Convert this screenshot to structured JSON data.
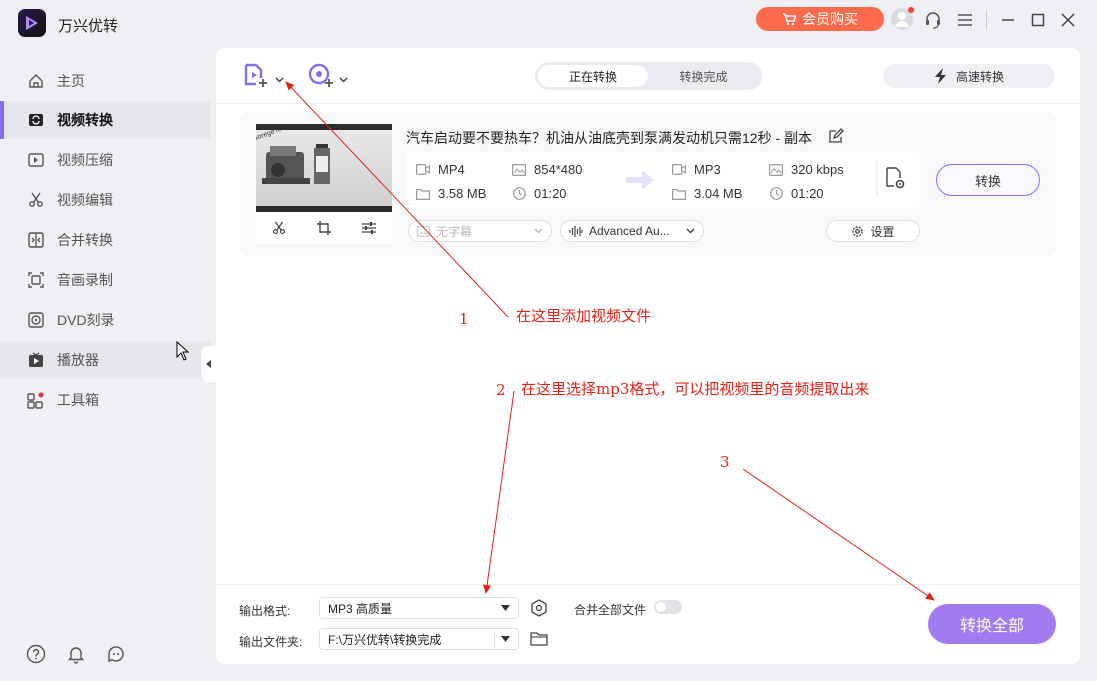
{
  "app": {
    "title": "万兴优转",
    "vip_label": "会员购买"
  },
  "sidebar": {
    "items": [
      {
        "label": "主页",
        "icon": "home-icon"
      },
      {
        "label": "视频转换",
        "icon": "convert-icon"
      },
      {
        "label": "视频压缩",
        "icon": "compress-icon"
      },
      {
        "label": "视频编辑",
        "icon": "scissors-icon"
      },
      {
        "label": "合并转换",
        "icon": "merge-icon"
      },
      {
        "label": "音画录制",
        "icon": "record-icon"
      },
      {
        "label": "DVD刻录",
        "icon": "dvd-icon"
      },
      {
        "label": "播放器",
        "icon": "player-icon"
      },
      {
        "label": "工具箱",
        "icon": "toolbox-icon"
      }
    ]
  },
  "toolbar": {
    "tab_converting": "正在转换",
    "tab_done": "转换完成",
    "fast_convert": "高速转换"
  },
  "file": {
    "title": "汽车启动要不要热车？机油从油底壳到泵满发动机只需12秒 - 副本",
    "thumb_brand": "GoregeTech",
    "source": {
      "format": "MP4",
      "resolution": "854*480",
      "size": "3.58 MB",
      "duration": "01:20"
    },
    "target": {
      "format": "MP3",
      "bitrate": "320 kbps",
      "size": "3.04 MB",
      "duration": "01:20"
    },
    "convert_label": "转换",
    "subtitle_placeholder": "无字幕",
    "audio_track": "Advanced Au...",
    "settings_label": "设置"
  },
  "bottom": {
    "format_label": "输出格式:",
    "format_value": "MP3 高质量",
    "merge_label": "合并全部文件",
    "folder_label": "输出文件夹:",
    "folder_value": "F:\\万兴优转\\转换完成",
    "convert_all": "转换全部"
  },
  "annotations": {
    "n1": "1",
    "t1": "在这里添加视频文件",
    "n2": "2",
    "t2": "在这里选择mp3格式，可以把视频里的音频提取出来",
    "n3": "3"
  },
  "colors": {
    "accent": "#8a6cf0",
    "vip": "#ff6a4a",
    "annotation": "#e2231a",
    "convert_all": "#a07cf0"
  }
}
